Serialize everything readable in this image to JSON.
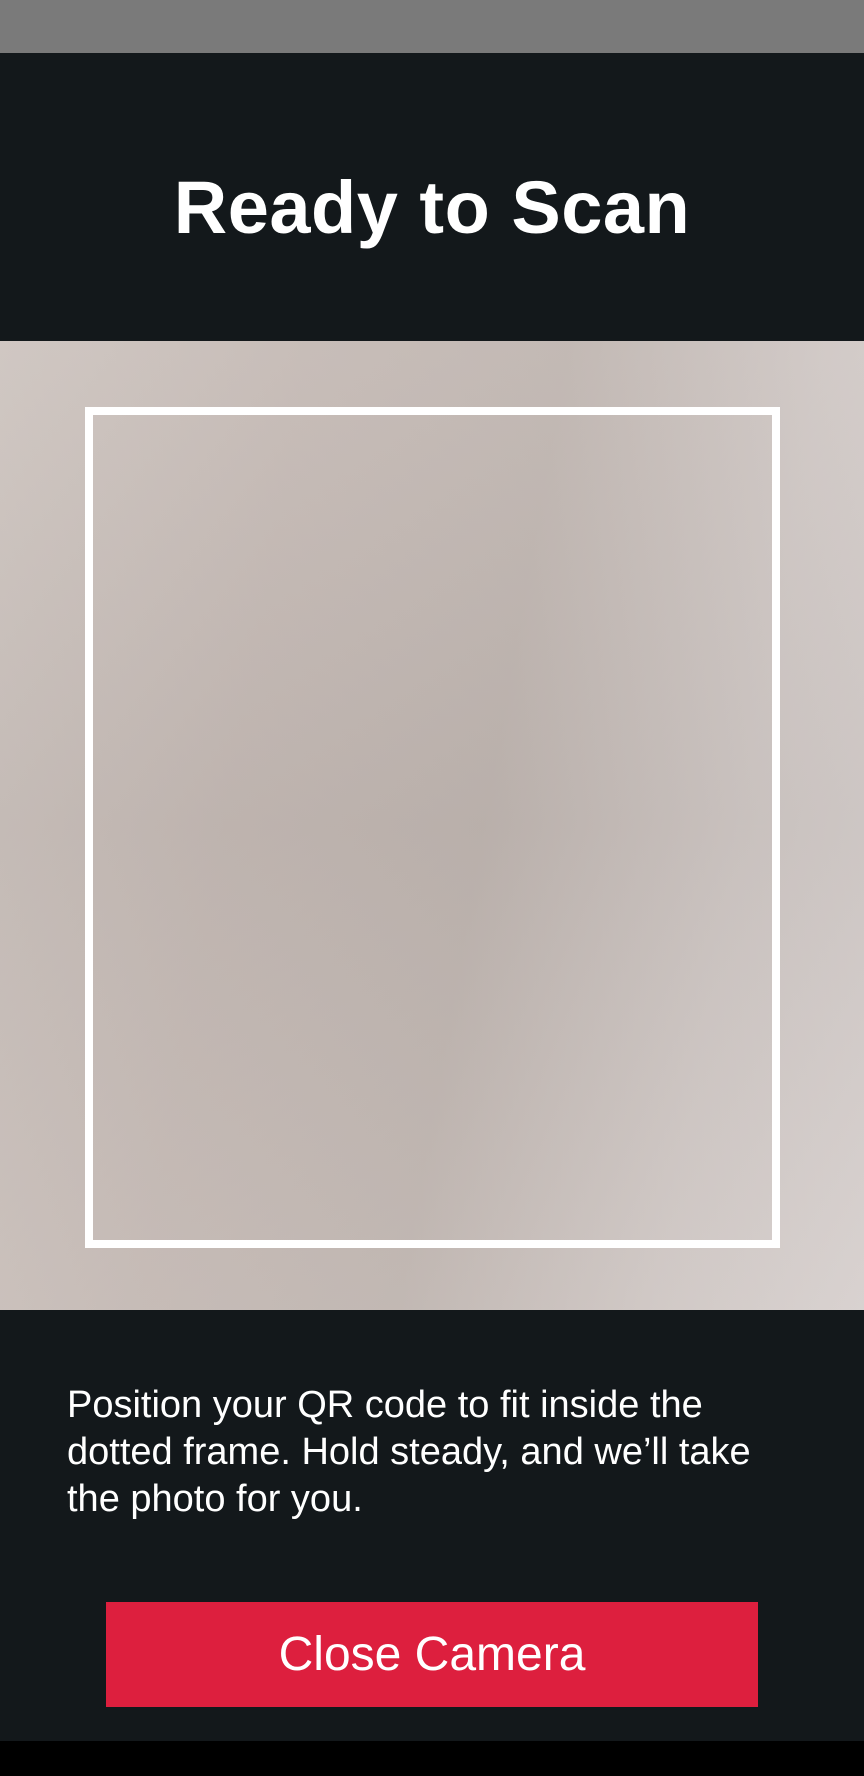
{
  "header": {
    "title": "Ready to Scan"
  },
  "scanner": {
    "frame_icon": "scan-frame"
  },
  "footer": {
    "instructions": "Position your QR code to fit inside the dotted frame. Hold steady, and we’ll take the photo for you.",
    "close_button_label": "Close Camera"
  },
  "colors": {
    "background": "#13181b",
    "button": "#dd1f3e",
    "text": "#ffffff",
    "status_bar": "#7a7a7a"
  }
}
